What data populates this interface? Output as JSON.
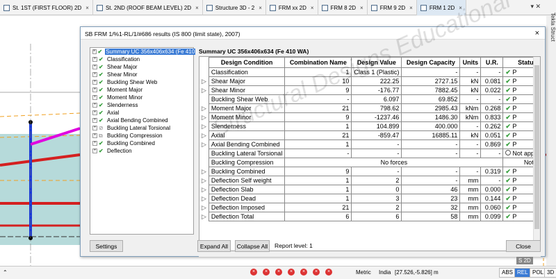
{
  "tabs": [
    {
      "label": "St. 1ST (FIRST FLOOR) 2D",
      "active": false
    },
    {
      "label": "St. 2ND (ROOF BEAM LEVEL) 2D",
      "active": false
    },
    {
      "label": "Structure 3D - 2",
      "active": false
    },
    {
      "label": "FRM xx 2D",
      "active": false
    },
    {
      "label": "FRM 8 2D",
      "active": false
    },
    {
      "label": "FRM 9 2D",
      "active": false
    },
    {
      "label": "FRM 1 2D",
      "active": true
    }
  ],
  "side_title": "Tekla Struct",
  "dialog": {
    "title": "SB FRM 1/%1-RL/1/#686 results (IS 800 (limit state), 2007)",
    "close": "×",
    "result_title": "Summary UC 356x406x634 (Fe 410 WA)"
  },
  "tree": [
    {
      "label": "Summary UC 356x406x634 (Fe 410",
      "status": "ok",
      "selected": true
    },
    {
      "label": "Classification",
      "status": "ok"
    },
    {
      "label": "Shear Major",
      "status": "ok"
    },
    {
      "label": "Shear Minor",
      "status": "ok"
    },
    {
      "label": "Buckling Shear Web",
      "status": "ok"
    },
    {
      "label": "Moment Major",
      "status": "ok"
    },
    {
      "label": "Moment Minor",
      "status": "ok"
    },
    {
      "label": "Slenderness",
      "status": "ok"
    },
    {
      "label": "Axial",
      "status": "ok"
    },
    {
      "label": "Axial Bending Combined",
      "status": "ok"
    },
    {
      "label": "Buckling Lateral Torsional",
      "status": "na"
    },
    {
      "label": "Buckling Compression",
      "status": "copy"
    },
    {
      "label": "Buckling Combined",
      "status": "ok"
    },
    {
      "label": "Deflection",
      "status": "ok"
    }
  ],
  "table": {
    "headers": [
      "Design Condition",
      "Combination Name",
      "Design Value",
      "Design Capacity",
      "Units",
      "U.R.",
      "Status"
    ],
    "rows": [
      [
        "Classification",
        "1",
        "Class 1 (Plastic)",
        "-",
        "-",
        "-",
        "P"
      ],
      [
        "Shear Major",
        "10",
        "222.25",
        "2727.15",
        "kN",
        "0.081",
        "P"
      ],
      [
        "Shear Minor",
        "9",
        "-176.77",
        "7882.45",
        "kN",
        "0.022",
        "P"
      ],
      [
        "Buckling Shear Web",
        "-",
        "6.097",
        "69.852",
        "-",
        "-",
        "P"
      ],
      [
        "Moment Major",
        "21",
        "798.62",
        "2985.43",
        "kNm",
        "0.268",
        "P"
      ],
      [
        "Moment Minor",
        "9",
        "-1237.46",
        "1486.30",
        "kNm",
        "0.833",
        "P"
      ],
      [
        "Slenderness",
        "1",
        "104.899",
        "400.000",
        "-",
        "0.262",
        "P"
      ],
      [
        "Axial",
        "21",
        "-859.47",
        "16885.11",
        "kN",
        "0.051",
        "P"
      ],
      [
        "Axial Bending Combined",
        "1",
        "-",
        "-",
        "-",
        "0.869",
        "P"
      ],
      [
        "Buckling Lateral Torsional",
        "-",
        "-",
        "-",
        "-",
        "-",
        "Not applica"
      ],
      [
        "Buckling Compression",
        "No forces",
        "",
        "",
        "",
        "",
        "Not requi"
      ],
      [
        "Buckling Combined",
        "9",
        "-",
        "-",
        "-",
        "0.319",
        "P"
      ],
      [
        "Deflection Self weight",
        "1",
        "2",
        "-",
        "mm",
        "-",
        "P"
      ],
      [
        "Deflection Slab",
        "1",
        "0",
        "46",
        "mm",
        "0.000",
        "P"
      ],
      [
        "Deflection Dead",
        "1",
        "3",
        "23",
        "mm",
        "0.144",
        "P"
      ],
      [
        "Deflection Imposed",
        "21",
        "2",
        "32",
        "mm",
        "0.060",
        "P"
      ],
      [
        "Deflection Total",
        "6",
        "6",
        "58",
        "mm",
        "0.099",
        "P"
      ]
    ]
  },
  "buttons": {
    "settings": "Settings",
    "expand_all": "Expand All",
    "collapse_all": "Collapse All",
    "close": "Close"
  },
  "report_level": "Report level: 1",
  "watermark": "Structural Designs Educational",
  "statusbar": {
    "metric": "Metric",
    "region": "India",
    "coords": "[27.526,-5.826] m",
    "abs": "ABS",
    "rel": "REL",
    "pol": "POL",
    "three_d": "3D"
  },
  "view_badges": {
    "s": "S",
    "two_d": "2D"
  },
  "colors": {
    "accent": "#3a7bd5",
    "ok": "#3aa040",
    "beam_red": "#d42020",
    "column_blue": "#1a3ad8",
    "magenta": "#e000e0"
  }
}
